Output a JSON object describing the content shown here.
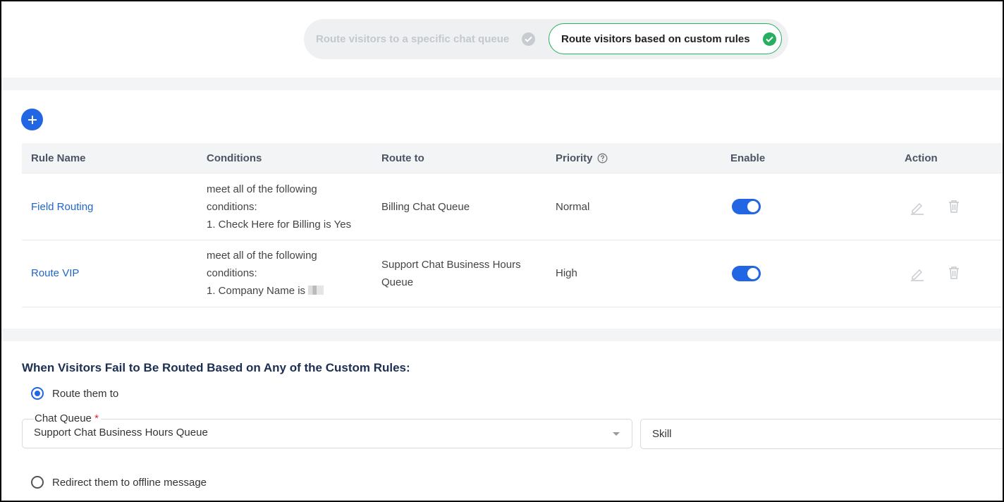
{
  "routing_mode": {
    "option_queue": "Route visitors to a specific chat queue",
    "option_rules": "Route visitors based on custom rules",
    "selected": "option_rules"
  },
  "table": {
    "headers": {
      "rule_name": "Rule Name",
      "conditions": "Conditions",
      "route_to": "Route to",
      "priority": "Priority",
      "enable": "Enable",
      "action": "Action"
    },
    "rows": [
      {
        "rule_name": "Field Routing",
        "conditions": [
          "meet all of the following",
          "conditions:",
          "1. Check Here for Billing is Yes"
        ],
        "route_to": [
          "Billing Chat Queue"
        ],
        "priority": "Normal",
        "enabled": true
      },
      {
        "rule_name": "Route VIP",
        "conditions": [
          "meet all of the following",
          "conditions:",
          "1. Company Name is"
        ],
        "route_to": [
          "Support Chat Business Hours",
          "Queue"
        ],
        "priority": "High",
        "enabled": true
      }
    ]
  },
  "fallback": {
    "title": "When Visitors Fail to Be Routed Based on Any of the Custom Rules:",
    "option_route": "Route them to",
    "option_offline": "Redirect them to offline message",
    "selected": "option_route",
    "chat_queue_label": "Chat Queue",
    "required_mark": "*",
    "chat_queue_value": "Support Chat Business Hours Queue",
    "skill_placeholder": "Skill"
  },
  "colors": {
    "accent": "#2266e3",
    "success": "#27ae60",
    "link": "#2266c5",
    "title": "#1c2f52"
  },
  "icons": [
    "check-circle-icon",
    "plus-icon",
    "help-icon",
    "edit-icon",
    "trash-icon",
    "chevron-down-icon"
  ]
}
